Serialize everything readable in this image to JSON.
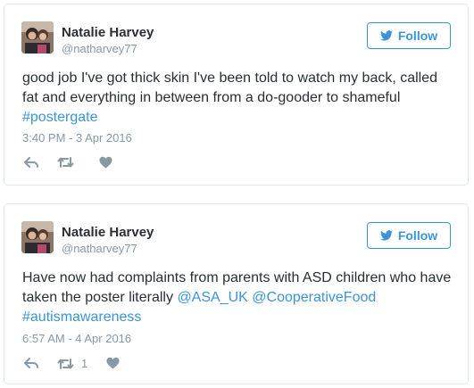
{
  "colors": {
    "link": "#3b94d9",
    "muted": "#8899a6",
    "text": "#292f33",
    "border": "#e1e8ed"
  },
  "tweets": [
    {
      "display_name": "Natalie Harvey",
      "handle": "@natharvey77",
      "follow_label": "Follow",
      "text_plain": "good job I've got thick skin I've been told to watch my back, called fat and everything in between from a do-gooder to shameful",
      "hashtags": [
        "#postergate"
      ],
      "timestamp": "3:40 PM - 3 Apr 2016",
      "retweet_count": ""
    },
    {
      "display_name": "Natalie Harvey",
      "handle": "@natharvey77",
      "follow_label": "Follow",
      "text_plain": "Have now had complaints from parents with ASD children who have taken the poster literally",
      "mentions": [
        "@ASA_UK",
        "@CooperativeFood"
      ],
      "hashtags": [
        "#autismawareness"
      ],
      "timestamp": "6:57 AM - 4 Apr 2016",
      "retweet_count": "1"
    }
  ],
  "icons": [
    "twitter-bird-icon",
    "reply-icon",
    "retweet-icon",
    "heart-icon"
  ]
}
